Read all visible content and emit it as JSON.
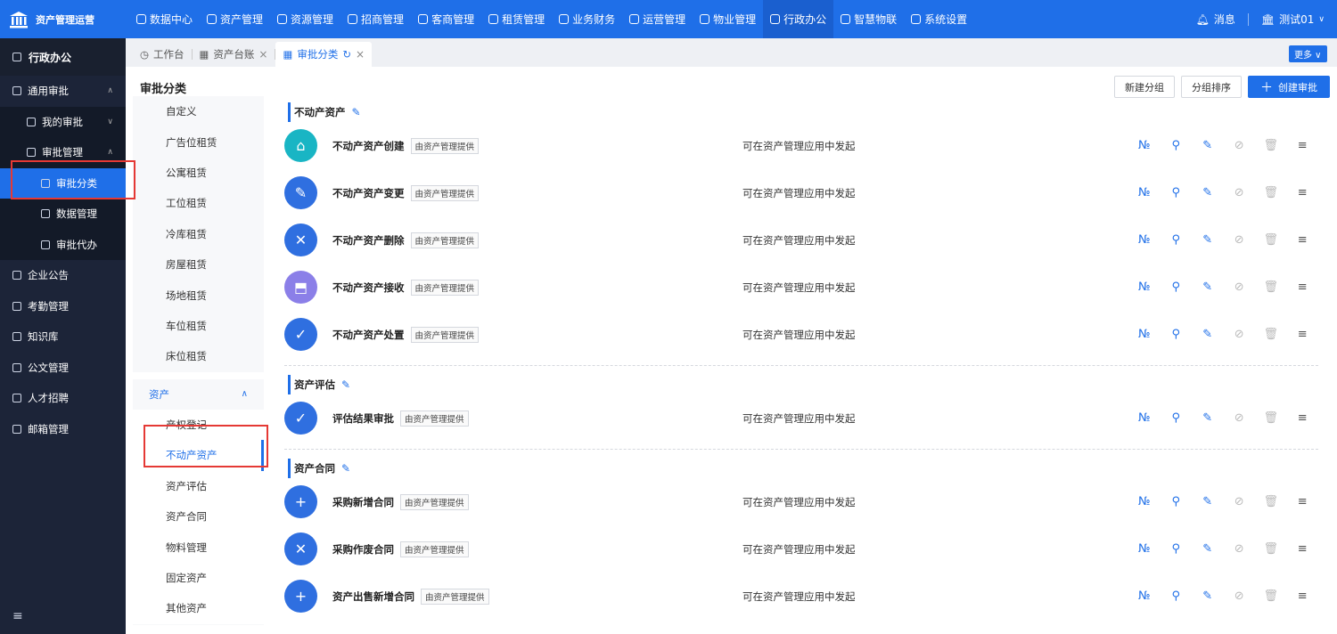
{
  "brand": {
    "name": "资产管理运营"
  },
  "topnav": [
    {
      "label": "数据中心",
      "active": false
    },
    {
      "label": "资产管理",
      "active": false
    },
    {
      "label": "资源管理",
      "active": false
    },
    {
      "label": "招商管理",
      "active": false
    },
    {
      "label": "客商管理",
      "active": false
    },
    {
      "label": "租赁管理",
      "active": false
    },
    {
      "label": "业务财务",
      "active": false
    },
    {
      "label": "运营管理",
      "active": false
    },
    {
      "label": "物业管理",
      "active": false
    },
    {
      "label": "行政办公",
      "active": true
    },
    {
      "label": "智慧物联",
      "active": false
    },
    {
      "label": "系统设置",
      "active": false
    }
  ],
  "top_right": {
    "messages": "消息",
    "user": "测试01"
  },
  "sidebar": {
    "title": "行政办公",
    "items": [
      {
        "label": "通用审批",
        "level": 1,
        "chevron": "up"
      },
      {
        "label": "我的审批",
        "level": 2,
        "chevron": "down"
      },
      {
        "label": "审批管理",
        "level": 2,
        "chevron": "up"
      },
      {
        "label": "审批分类",
        "level": 3,
        "active": true
      },
      {
        "label": "数据管理",
        "level": 3
      },
      {
        "label": "审批代办",
        "level": 3
      },
      {
        "label": "企业公告",
        "level": 1
      },
      {
        "label": "考勤管理",
        "level": 1
      },
      {
        "label": "知识库",
        "level": 1
      },
      {
        "label": "公文管理",
        "level": 1
      },
      {
        "label": "人才招聘",
        "level": 1
      },
      {
        "label": "邮箱管理",
        "level": 1
      }
    ],
    "collapse_icon": "≡"
  },
  "tabs": [
    {
      "label": "工作台",
      "closable": false,
      "active": false
    },
    {
      "label": "资产台账",
      "closable": true,
      "active": false
    },
    {
      "label": "审批分类",
      "closable": true,
      "active": true
    }
  ],
  "more_label": "更多",
  "page": {
    "title": "审批分类",
    "actions": {
      "new_group": "新建分组",
      "sort_group": "分组排序",
      "create": "创建审批"
    }
  },
  "categories": {
    "top_items": [
      "自定义",
      "广告位租赁",
      "公寓租赁",
      "工位租赁",
      "冷库租赁",
      "房屋租赁",
      "场地租赁",
      "车位租赁",
      "床位租赁"
    ],
    "group": "资产",
    "sub_items": [
      "产权登记",
      "不动产资产",
      "资产评估",
      "资产合同",
      "物料管理",
      "固定资产",
      "其他资产"
    ],
    "active": "不动产资产"
  },
  "groups": [
    {
      "title": "不动产资产",
      "rows": [
        {
          "name": "不动产资产创建",
          "badge": "由资产管理提供",
          "desc": "可在资产管理应用中发起",
          "color": "#19b5c4",
          "icon": "⌂"
        },
        {
          "name": "不动产资产变更",
          "badge": "由资产管理提供",
          "desc": "可在资产管理应用中发起",
          "color": "#2f6fe0",
          "icon": "✎"
        },
        {
          "name": "不动产资产删除",
          "badge": "由资产管理提供",
          "desc": "可在资产管理应用中发起",
          "color": "#2f6fe0",
          "icon": "✕"
        },
        {
          "name": "不动产资产接收",
          "badge": "由资产管理提供",
          "desc": "可在资产管理应用中发起",
          "color": "#8b7fe8",
          "icon": "⬒"
        },
        {
          "name": "不动产资产处置",
          "badge": "由资产管理提供",
          "desc": "可在资产管理应用中发起",
          "color": "#2f6fe0",
          "icon": "✓"
        }
      ]
    },
    {
      "title": "资产评估",
      "rows": [
        {
          "name": "评估结果审批",
          "badge": "由资产管理提供",
          "desc": "可在资产管理应用中发起",
          "color": "#2f6fe0",
          "icon": "✓"
        }
      ]
    },
    {
      "title": "资产合同",
      "rows": [
        {
          "name": "采购新增合同",
          "badge": "由资产管理提供",
          "desc": "可在资产管理应用中发起",
          "color": "#2f6fe0",
          "icon": "+"
        },
        {
          "name": "采购作废合同",
          "badge": "由资产管理提供",
          "desc": "可在资产管理应用中发起",
          "color": "#2f6fe0",
          "icon": "✕"
        },
        {
          "name": "资产出售新增合同",
          "badge": "由资产管理提供",
          "desc": "可在资产管理应用中发起",
          "color": "#2f6fe0",
          "icon": "+"
        }
      ]
    }
  ],
  "row_ops": [
    {
      "name": "number-icon",
      "glyph": "№",
      "state": "blue"
    },
    {
      "name": "flow-icon",
      "glyph": "⚲",
      "state": "blue"
    },
    {
      "name": "edit-icon",
      "glyph": "✎",
      "state": "blue"
    },
    {
      "name": "disable-icon",
      "glyph": "⊘",
      "state": "disabled"
    },
    {
      "name": "delete-icon",
      "glyph": "🗑",
      "state": "disabled"
    },
    {
      "name": "drag-icon",
      "glyph": "≡",
      "state": "dark"
    }
  ],
  "colors": {
    "primary": "#1f6fe8",
    "sidebar": "#1c2438",
    "highlight_box": "#e53935"
  }
}
